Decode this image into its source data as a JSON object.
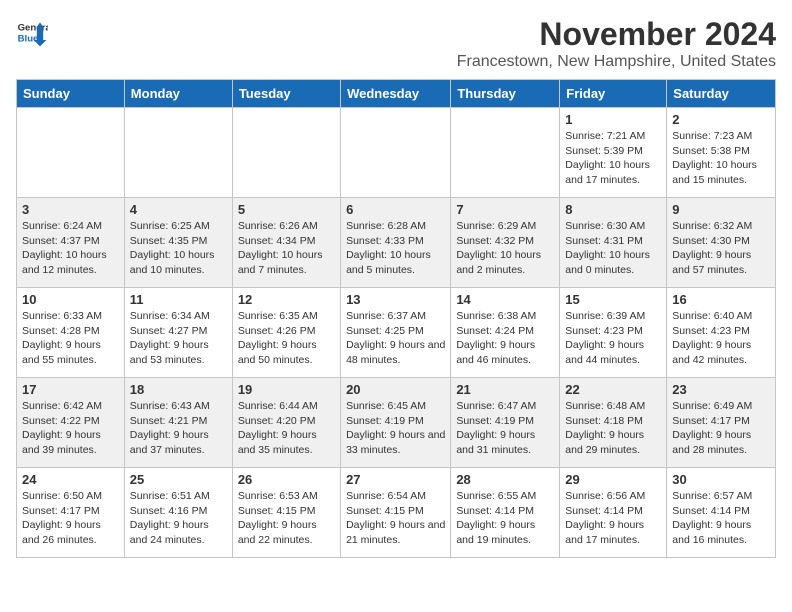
{
  "header": {
    "logo_line1": "General",
    "logo_line2": "Blue",
    "month_title": "November 2024",
    "location": "Francestown, New Hampshire, United States"
  },
  "weekdays": [
    "Sunday",
    "Monday",
    "Tuesday",
    "Wednesday",
    "Thursday",
    "Friday",
    "Saturday"
  ],
  "weeks": [
    [
      {
        "day": "",
        "info": ""
      },
      {
        "day": "",
        "info": ""
      },
      {
        "day": "",
        "info": ""
      },
      {
        "day": "",
        "info": ""
      },
      {
        "day": "",
        "info": ""
      },
      {
        "day": "1",
        "info": "Sunrise: 7:21 AM\nSunset: 5:39 PM\nDaylight: 10 hours and 17 minutes."
      },
      {
        "day": "2",
        "info": "Sunrise: 7:23 AM\nSunset: 5:38 PM\nDaylight: 10 hours and 15 minutes."
      }
    ],
    [
      {
        "day": "3",
        "info": "Sunrise: 6:24 AM\nSunset: 4:37 PM\nDaylight: 10 hours and 12 minutes."
      },
      {
        "day": "4",
        "info": "Sunrise: 6:25 AM\nSunset: 4:35 PM\nDaylight: 10 hours and 10 minutes."
      },
      {
        "day": "5",
        "info": "Sunrise: 6:26 AM\nSunset: 4:34 PM\nDaylight: 10 hours and 7 minutes."
      },
      {
        "day": "6",
        "info": "Sunrise: 6:28 AM\nSunset: 4:33 PM\nDaylight: 10 hours and 5 minutes."
      },
      {
        "day": "7",
        "info": "Sunrise: 6:29 AM\nSunset: 4:32 PM\nDaylight: 10 hours and 2 minutes."
      },
      {
        "day": "8",
        "info": "Sunrise: 6:30 AM\nSunset: 4:31 PM\nDaylight: 10 hours and 0 minutes."
      },
      {
        "day": "9",
        "info": "Sunrise: 6:32 AM\nSunset: 4:30 PM\nDaylight: 9 hours and 57 minutes."
      }
    ],
    [
      {
        "day": "10",
        "info": "Sunrise: 6:33 AM\nSunset: 4:28 PM\nDaylight: 9 hours and 55 minutes."
      },
      {
        "day": "11",
        "info": "Sunrise: 6:34 AM\nSunset: 4:27 PM\nDaylight: 9 hours and 53 minutes."
      },
      {
        "day": "12",
        "info": "Sunrise: 6:35 AM\nSunset: 4:26 PM\nDaylight: 9 hours and 50 minutes."
      },
      {
        "day": "13",
        "info": "Sunrise: 6:37 AM\nSunset: 4:25 PM\nDaylight: 9 hours and 48 minutes."
      },
      {
        "day": "14",
        "info": "Sunrise: 6:38 AM\nSunset: 4:24 PM\nDaylight: 9 hours and 46 minutes."
      },
      {
        "day": "15",
        "info": "Sunrise: 6:39 AM\nSunset: 4:23 PM\nDaylight: 9 hours and 44 minutes."
      },
      {
        "day": "16",
        "info": "Sunrise: 6:40 AM\nSunset: 4:23 PM\nDaylight: 9 hours and 42 minutes."
      }
    ],
    [
      {
        "day": "17",
        "info": "Sunrise: 6:42 AM\nSunset: 4:22 PM\nDaylight: 9 hours and 39 minutes."
      },
      {
        "day": "18",
        "info": "Sunrise: 6:43 AM\nSunset: 4:21 PM\nDaylight: 9 hours and 37 minutes."
      },
      {
        "day": "19",
        "info": "Sunrise: 6:44 AM\nSunset: 4:20 PM\nDaylight: 9 hours and 35 minutes."
      },
      {
        "day": "20",
        "info": "Sunrise: 6:45 AM\nSunset: 4:19 PM\nDaylight: 9 hours and 33 minutes."
      },
      {
        "day": "21",
        "info": "Sunrise: 6:47 AM\nSunset: 4:19 PM\nDaylight: 9 hours and 31 minutes."
      },
      {
        "day": "22",
        "info": "Sunrise: 6:48 AM\nSunset: 4:18 PM\nDaylight: 9 hours and 29 minutes."
      },
      {
        "day": "23",
        "info": "Sunrise: 6:49 AM\nSunset: 4:17 PM\nDaylight: 9 hours and 28 minutes."
      }
    ],
    [
      {
        "day": "24",
        "info": "Sunrise: 6:50 AM\nSunset: 4:17 PM\nDaylight: 9 hours and 26 minutes."
      },
      {
        "day": "25",
        "info": "Sunrise: 6:51 AM\nSunset: 4:16 PM\nDaylight: 9 hours and 24 minutes."
      },
      {
        "day": "26",
        "info": "Sunrise: 6:53 AM\nSunset: 4:15 PM\nDaylight: 9 hours and 22 minutes."
      },
      {
        "day": "27",
        "info": "Sunrise: 6:54 AM\nSunset: 4:15 PM\nDaylight: 9 hours and 21 minutes."
      },
      {
        "day": "28",
        "info": "Sunrise: 6:55 AM\nSunset: 4:14 PM\nDaylight: 9 hours and 19 minutes."
      },
      {
        "day": "29",
        "info": "Sunrise: 6:56 AM\nSunset: 4:14 PM\nDaylight: 9 hours and 17 minutes."
      },
      {
        "day": "30",
        "info": "Sunrise: 6:57 AM\nSunset: 4:14 PM\nDaylight: 9 hours and 16 minutes."
      }
    ]
  ]
}
